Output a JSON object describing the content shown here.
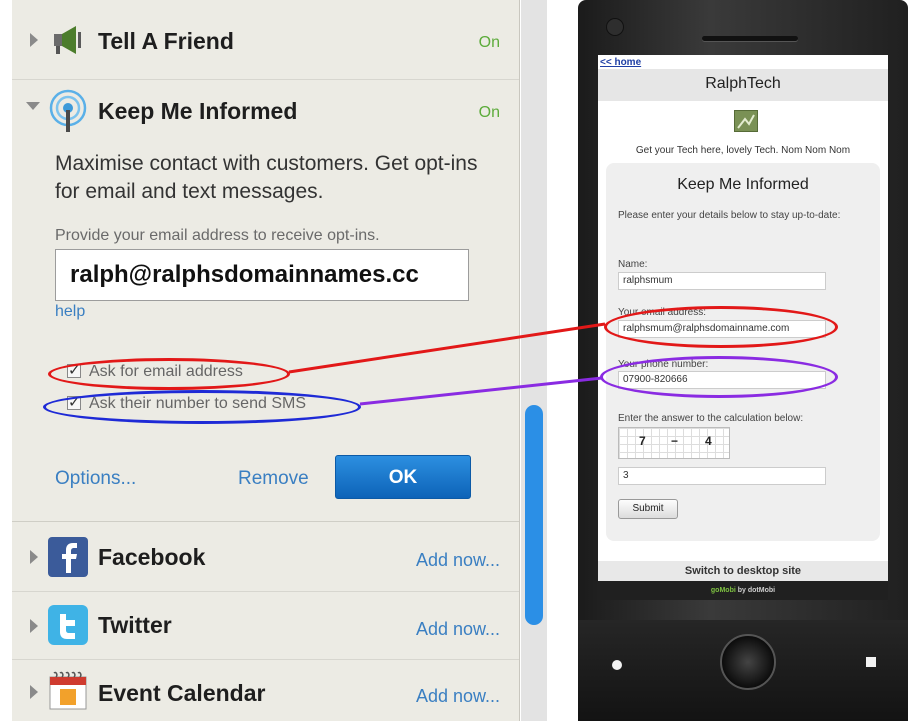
{
  "panel": {
    "rows": {
      "tell_a_friend": {
        "title": "Tell A Friend",
        "status": "On"
      },
      "keep_me_informed": {
        "title": "Keep Me Informed",
        "status": "On",
        "description": "Maximise contact with customers. Get opt-ins for email and text messages.",
        "email_hint": "Provide your email address to receive opt-ins.",
        "email_value": "ralph@ralphsdomainnames.cc",
        "help_label": "help",
        "checkbox_email_label": "Ask for email address",
        "checkbox_email_checked": true,
        "checkbox_sms_label": "Ask their number to send SMS",
        "checkbox_sms_checked": true,
        "options_label": "Options...",
        "remove_label": "Remove",
        "ok_label": "OK"
      },
      "facebook": {
        "title": "Facebook",
        "action": "Add now..."
      },
      "twitter": {
        "title": "Twitter",
        "action": "Add now..."
      },
      "event_calendar": {
        "title": "Event Calendar",
        "action": "Add now..."
      }
    },
    "accent_color": "#3a7fc2",
    "status_color": "#5cab3a",
    "ok_button_color": "#1f7bd1"
  },
  "phone": {
    "home_link": "<< home",
    "site_title": "RalphTech",
    "tagline": "Get your Tech here, lovely Tech. Nom Nom Nom",
    "form": {
      "title": "Keep Me Informed",
      "intro": "Please enter your details below to stay up-to-date:",
      "name_label": "Name:",
      "name_value": "ralphsmum",
      "email_label": "Your email address:",
      "email_value": "ralphsmum@ralphsdomainname.com",
      "phone_label": "Your phone number:",
      "phone_value": "07900-820666",
      "calc_label": "Enter the answer to the calculation below:",
      "captcha": {
        "left": "7",
        "operator": "−",
        "right": "4"
      },
      "answer_value": "3",
      "submit_label": "Submit"
    },
    "desktop_link": "Switch to desktop site",
    "powered_by": {
      "brand": "goMobi",
      "suffix": "by dotMobi"
    }
  },
  "annotations": {
    "email_color": "#e21818",
    "sms_left_color": "#1e2ad6",
    "sms_right_color": "#8a2be2"
  }
}
